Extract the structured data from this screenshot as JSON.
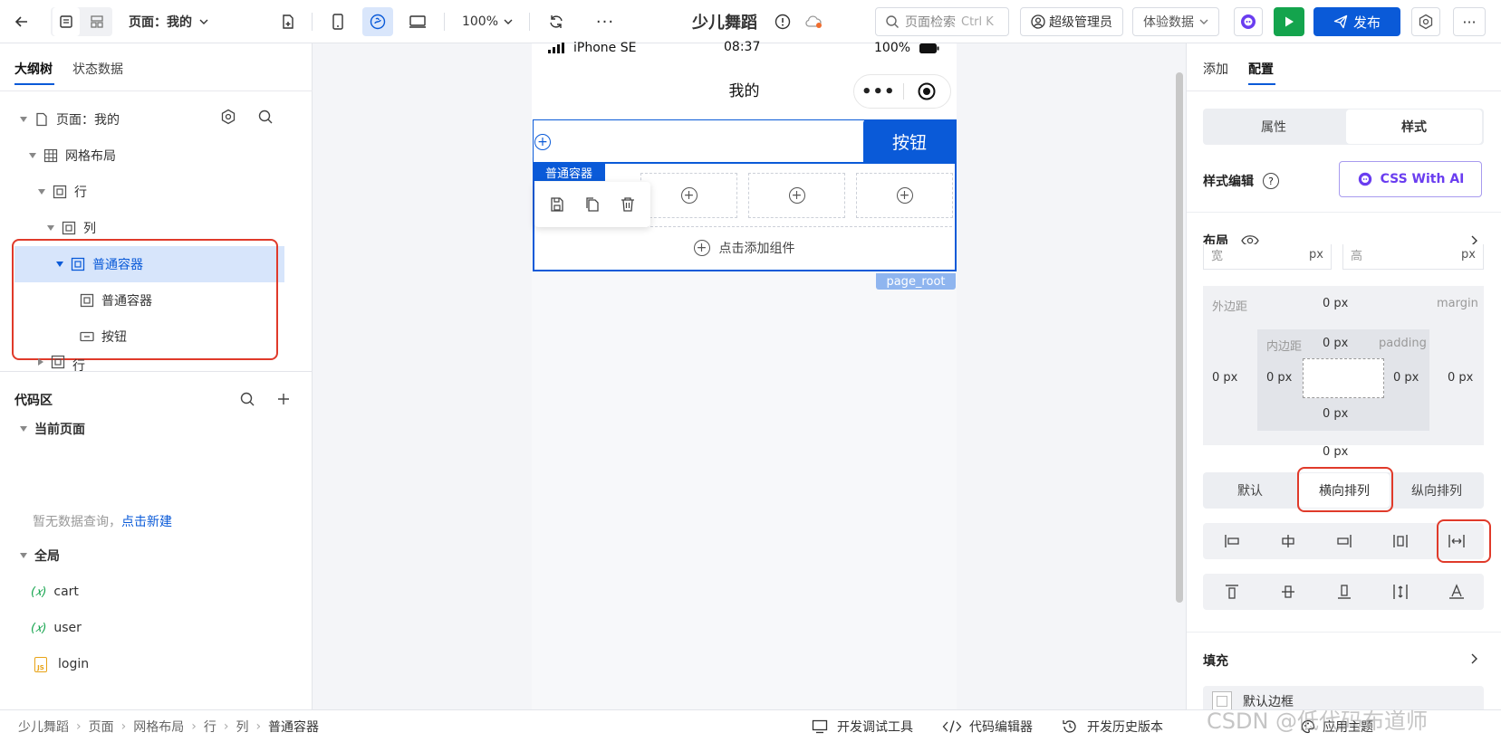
{
  "topbar": {
    "page_select": "页面：我的",
    "zoom": "100%",
    "app_title": "少儿舞蹈",
    "search_placeholder": "页面检索",
    "search_shortcut": "Ctrl K",
    "admin": "超级管理员",
    "data_mode": "体验数据",
    "publish": "发布"
  },
  "left": {
    "tabs": [
      "大纲树",
      "状态数据"
    ],
    "tree": [
      {
        "label": "页面：我的"
      },
      {
        "label": "网格布局"
      },
      {
        "label": "行"
      },
      {
        "label": "列"
      },
      {
        "label": "普通容器"
      },
      {
        "label": "普通容器"
      },
      {
        "label": "按钮"
      },
      {
        "label": "行"
      }
    ],
    "code_area": {
      "title": "代码区",
      "current_page": "当前页面",
      "empty_text": "暂无数据查询，",
      "create_link": "点击新建",
      "global": "全局",
      "items": [
        {
          "prefix": "(𝑥)",
          "name": "cart"
        },
        {
          "prefix": "(𝑥)",
          "name": "user"
        },
        {
          "prefix": "JS",
          "name": "login"
        }
      ]
    }
  },
  "phone": {
    "device": "iPhone SE",
    "time": "08:37",
    "battery": "100%",
    "nav_title": "我的",
    "button_label": "按钮",
    "container_tag": "普通容器",
    "add_component": "点击添加组件",
    "page_root": "page_root"
  },
  "right": {
    "tabs": [
      "添加",
      "配置"
    ],
    "seg": [
      "属性",
      "样式"
    ],
    "style_edit": "样式编辑",
    "css_ai": "CSS With AI",
    "layout": "布局",
    "width_label": "宽",
    "height_label": "高",
    "unit": "px",
    "margin_label": "外边距",
    "margin_en": "margin",
    "padding_label": "内边距",
    "padding_en": "padding",
    "zero_px": "0 px",
    "direction": [
      "默认",
      "横向排列",
      "纵向排列"
    ],
    "fill": "填充",
    "default_border": "默认边框"
  },
  "bottombar": {
    "breadcrumb": [
      "少儿舞蹈",
      "页面",
      "网格布局",
      "行",
      "列",
      "普通容器"
    ],
    "debug": "开发调试工具",
    "code_editor": "代码编辑器",
    "history": "开发历史版本",
    "theme": "应用主题",
    "watermark": "CSDN @低代码布道师"
  },
  "colors": {
    "primary": "#0a5ad8",
    "green": "#14a44d",
    "red": "#e03a2a"
  }
}
